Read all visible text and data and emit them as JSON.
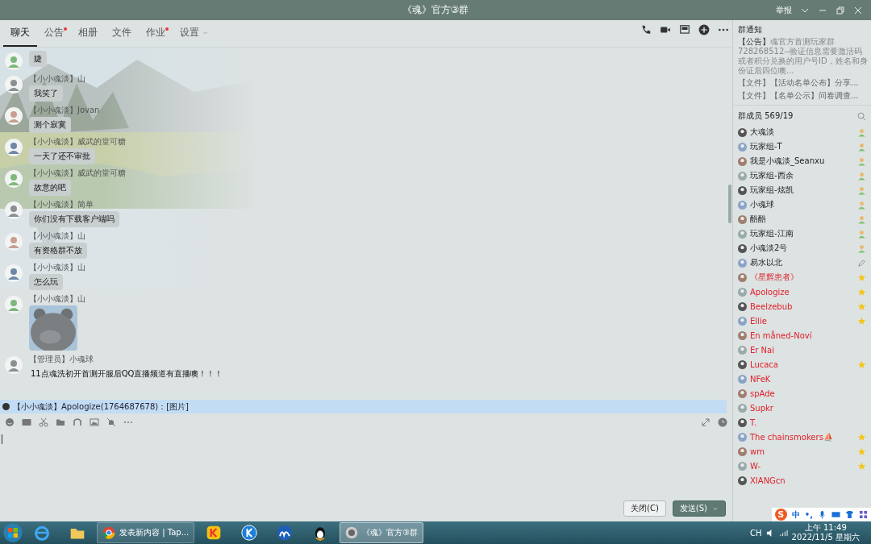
{
  "window": {
    "title": "《魂》官方③群",
    "report": "举报"
  },
  "tabs": [
    {
      "label": "聊天",
      "selected": true,
      "dot": false,
      "menu": false
    },
    {
      "label": "公告",
      "selected": false,
      "dot": true,
      "menu": false
    },
    {
      "label": "相册",
      "selected": false,
      "dot": false,
      "menu": false
    },
    {
      "label": "文件",
      "selected": false,
      "dot": false,
      "menu": false
    },
    {
      "label": "作业",
      "selected": false,
      "dot": true,
      "menu": false
    },
    {
      "label": "设置",
      "selected": false,
      "dot": false,
      "menu": true
    }
  ],
  "messages": [
    {
      "kind": "text",
      "text": "婕"
    },
    {
      "kind": "text",
      "sender": "【小小魂淡】山",
      "text": "我笑了"
    },
    {
      "kind": "text",
      "sender": "【小小魂淡】Jovan",
      "text": "测个寂寞"
    },
    {
      "kind": "text",
      "sender": "【小小魂淡】威武的堂可糖",
      "text": "一天了还不审批"
    },
    {
      "kind": "text",
      "sender": "【小小魂淡】威武的堂可糖",
      "text": "故意的吧"
    },
    {
      "kind": "text",
      "sender": "【小小魂淡】简单",
      "text": "你们没有下载客户端吗"
    },
    {
      "kind": "text",
      "sender": "【小小魂淡】山",
      "text": "有资格群不放"
    },
    {
      "kind": "text",
      "sender": "【小小魂淡】山",
      "text": "怎么玩"
    },
    {
      "kind": "sticker",
      "sender": "【小小魂淡】山"
    },
    {
      "kind": "plain",
      "sender": "【管理员】小魂球",
      "text": "11点魂洗初开首测开服后QQ直播频道有直播噢！！！"
    }
  ],
  "quote": "【小小魂淡】Apologize(1764687678)：[图片]",
  "actions": {
    "close": "关闭(C)",
    "send": "发送(S)"
  },
  "notice": {
    "title": "群通知",
    "announcement": "**【公告】**魂官方首测玩家群728268512--验证信息需要激活码或者积分兑换的用户号ID，姓名和身份证后四位噢...",
    "files": [
      "【文件】【活动名单公布】分享...",
      "【文件】【名单公示】问卷调查..."
    ]
  },
  "members": {
    "title": "群成员 569/19",
    "items": [
      {
        "name": "大魂淡",
        "highlighted": false,
        "kind": "admin"
      },
      {
        "name": "玩家组-T",
        "highlighted": false,
        "kind": "admin"
      },
      {
        "name": "我是小魂淡_Seanxu",
        "highlighted": false,
        "kind": "admin"
      },
      {
        "name": "玩家组-西余",
        "highlighted": false,
        "kind": "admin"
      },
      {
        "name": "玩家组-炫凯",
        "highlighted": false,
        "kind": "admin"
      },
      {
        "name": "小魂球",
        "highlighted": false,
        "kind": "admin"
      },
      {
        "name": "酷酷",
        "highlighted": false,
        "kind": "admin"
      },
      {
        "name": "玩家组-江南",
        "highlighted": false,
        "kind": "admin"
      },
      {
        "name": "小魂淡2号",
        "highlighted": false,
        "kind": "admin"
      },
      {
        "name": "易水以北",
        "highlighted": false,
        "kind": "edit"
      },
      {
        "name": "《星辉患者》",
        "highlighted": true,
        "kind": "star"
      },
      {
        "name": "Apologize",
        "highlighted": true,
        "kind": "star"
      },
      {
        "name": "Beelzebub",
        "highlighted": true,
        "kind": "star"
      },
      {
        "name": "Ellie",
        "highlighted": true,
        "kind": "star"
      },
      {
        "name": "En måned-Noví",
        "highlighted": true,
        "kind": "plain"
      },
      {
        "name": "Er Nai",
        "highlighted": true,
        "kind": "plain"
      },
      {
        "name": "Lucaca",
        "highlighted": true,
        "kind": "star"
      },
      {
        "name": "NFeK",
        "highlighted": true,
        "kind": "plain"
      },
      {
        "name": "spAde",
        "highlighted": true,
        "kind": "plain"
      },
      {
        "name": "Supkr",
        "highlighted": true,
        "kind": "plain"
      },
      {
        "name": "T.",
        "highlighted": true,
        "kind": "plain"
      },
      {
        "name": "The chainsmokers⛵",
        "highlighted": true,
        "kind": "star"
      },
      {
        "name": "wm",
        "highlighted": true,
        "kind": "star"
      },
      {
        "name": "W-",
        "highlighted": true,
        "kind": "star"
      },
      {
        "name": "XIANGcn",
        "highlighted": true,
        "kind": "plain"
      }
    ]
  },
  "ime": {
    "logo": "S",
    "mode": "中",
    "punct": "•,"
  },
  "taskbar": {
    "tasks": [
      {
        "kind": "chrome",
        "label": "发表新内容 | Tap...",
        "selected": false
      },
      {
        "kind": "app1"
      },
      {
        "kind": "app2"
      },
      {
        "kind": "app3"
      },
      {
        "kind": "qq"
      },
      {
        "kind": "group",
        "label": "《魂》官方③群",
        "selected": true
      }
    ],
    "lang": "CH",
    "time": "上午 11:49",
    "date": "2022/11/5 星期六"
  }
}
